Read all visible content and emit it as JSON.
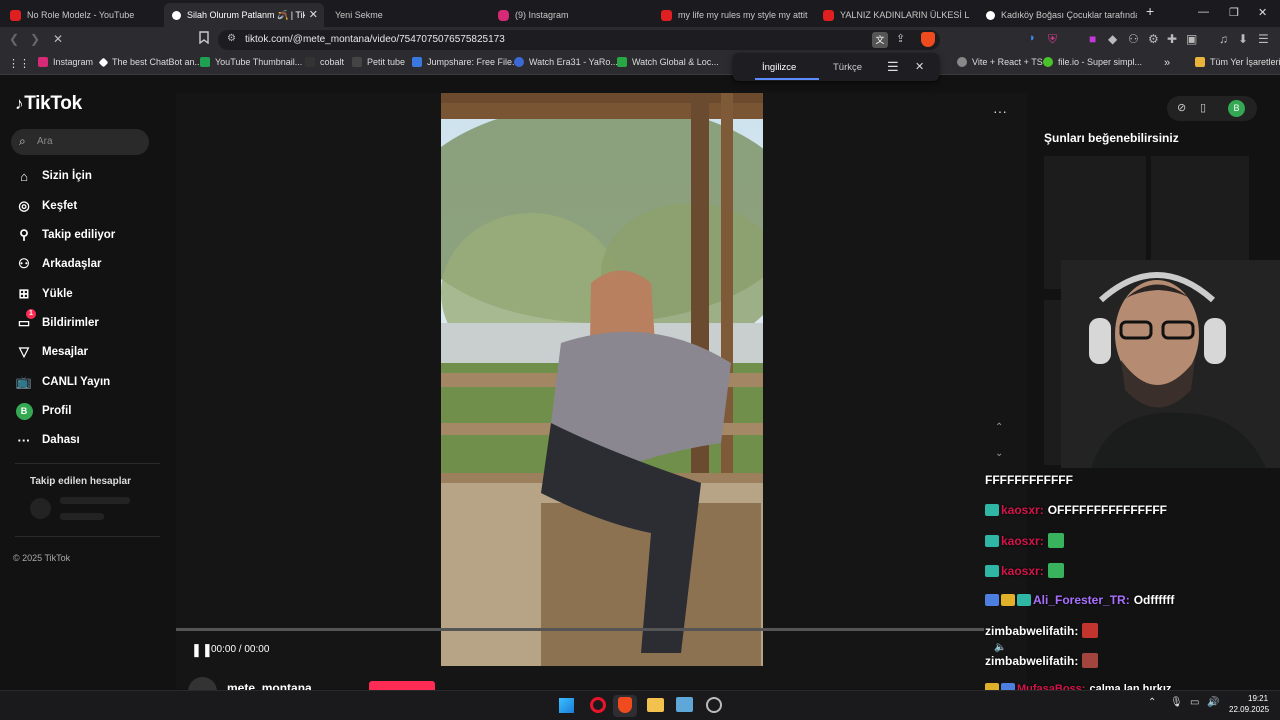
{
  "tabs": [
    {
      "title": "No Role Modelz - YouTube",
      "favicon": "youtube-icon",
      "active": false
    },
    {
      "title": "Silah Olurum Patlanm 🪃 | TikTo",
      "favicon": "tiktok-icon",
      "active": true
    },
    {
      "title": "Yeni Sekme",
      "favicon": "",
      "active": false
    },
    {
      "title": "(9) Instagram",
      "favicon": "instagram-icon",
      "active": false
    },
    {
      "title": "my life my rules my style my attitude",
      "favicon": "youtube-icon",
      "active": false
    },
    {
      "title": "YALNIZ KADINLARIN ÜLKESİ LİTVAN",
      "favicon": "youtube-icon",
      "active": false
    },
    {
      "title": "Kadıköy Boğası Çocuklar tarafından",
      "favicon": "tiktok-icon",
      "active": false
    }
  ],
  "address": {
    "url": "tiktok.com/@mete_montana/video/7547075076575825173"
  },
  "bookmarks": [
    "Instagram",
    "The best ChatBot an...",
    "YouTube Thumbnail...",
    "cobalt",
    "Petit tube",
    "Jumpshare: Free File...",
    "Watch Era31 - YaRo...",
    "Watch Global & Loc...",
    "Vite + React + TS",
    "file.io - Super simpl..."
  ],
  "bookmarks_folder": "Tüm Yer İşaretleri",
  "translate": {
    "from": "İngilizce",
    "to": "Türkçe"
  },
  "tiktok": {
    "logo": "TikTok",
    "search_placeholder": "Ara",
    "nav": [
      {
        "label": "Sizin İçin",
        "icon": "home-icon"
      },
      {
        "label": "Keşfet",
        "icon": "compass-icon"
      },
      {
        "label": "Takip ediliyor",
        "icon": "following-icon"
      },
      {
        "label": "Arkadaşlar",
        "icon": "friends-icon"
      },
      {
        "label": "Yükle",
        "icon": "upload-icon"
      },
      {
        "label": "Bildirimler",
        "icon": "inbox-icon",
        "badge": "1"
      },
      {
        "label": "Mesajlar",
        "icon": "message-icon"
      },
      {
        "label": "CANLI Yayın",
        "icon": "live-icon"
      },
      {
        "label": "Profil",
        "icon": "profile-icon",
        "avatar_letter": "B"
      },
      {
        "label": "Dahası",
        "icon": "more-icon"
      }
    ],
    "following_title": "Takip edilen hesaplar",
    "copyright": "© 2025 TikTok",
    "player": {
      "time": "00:00 / 00:00",
      "author": "mete_montana"
    },
    "recommend_title": "Şunları beğenebilirsiniz",
    "user_avatar_letter": "B"
  },
  "chat": [
    {
      "user": "",
      "message": "FFFFFFFFFFFF",
      "color": "#ffffff"
    },
    {
      "user": "kaosxr:",
      "message": "OFFFFFFFFFFFFFFF",
      "color": "#d5144b"
    },
    {
      "user": "kaosxr:",
      "message": "",
      "color": "#d5144b"
    },
    {
      "user": "kaosxr:",
      "message": "",
      "color": "#d5144b"
    },
    {
      "user": "Ali_Forester_TR:",
      "message": "Odffffff",
      "color": "#a970ff"
    },
    {
      "user": "zimbabwelifatih:",
      "message": "",
      "color": "#ffffff"
    },
    {
      "user": "zimbabwelifatih:",
      "message": "",
      "color": "#ffffff"
    },
    {
      "user": "MufasaBoss:",
      "message": "çalma lan hırkız",
      "color": "#d5144b"
    }
  ],
  "clock": {
    "time": "19:21",
    "date": "22.09.2025"
  }
}
